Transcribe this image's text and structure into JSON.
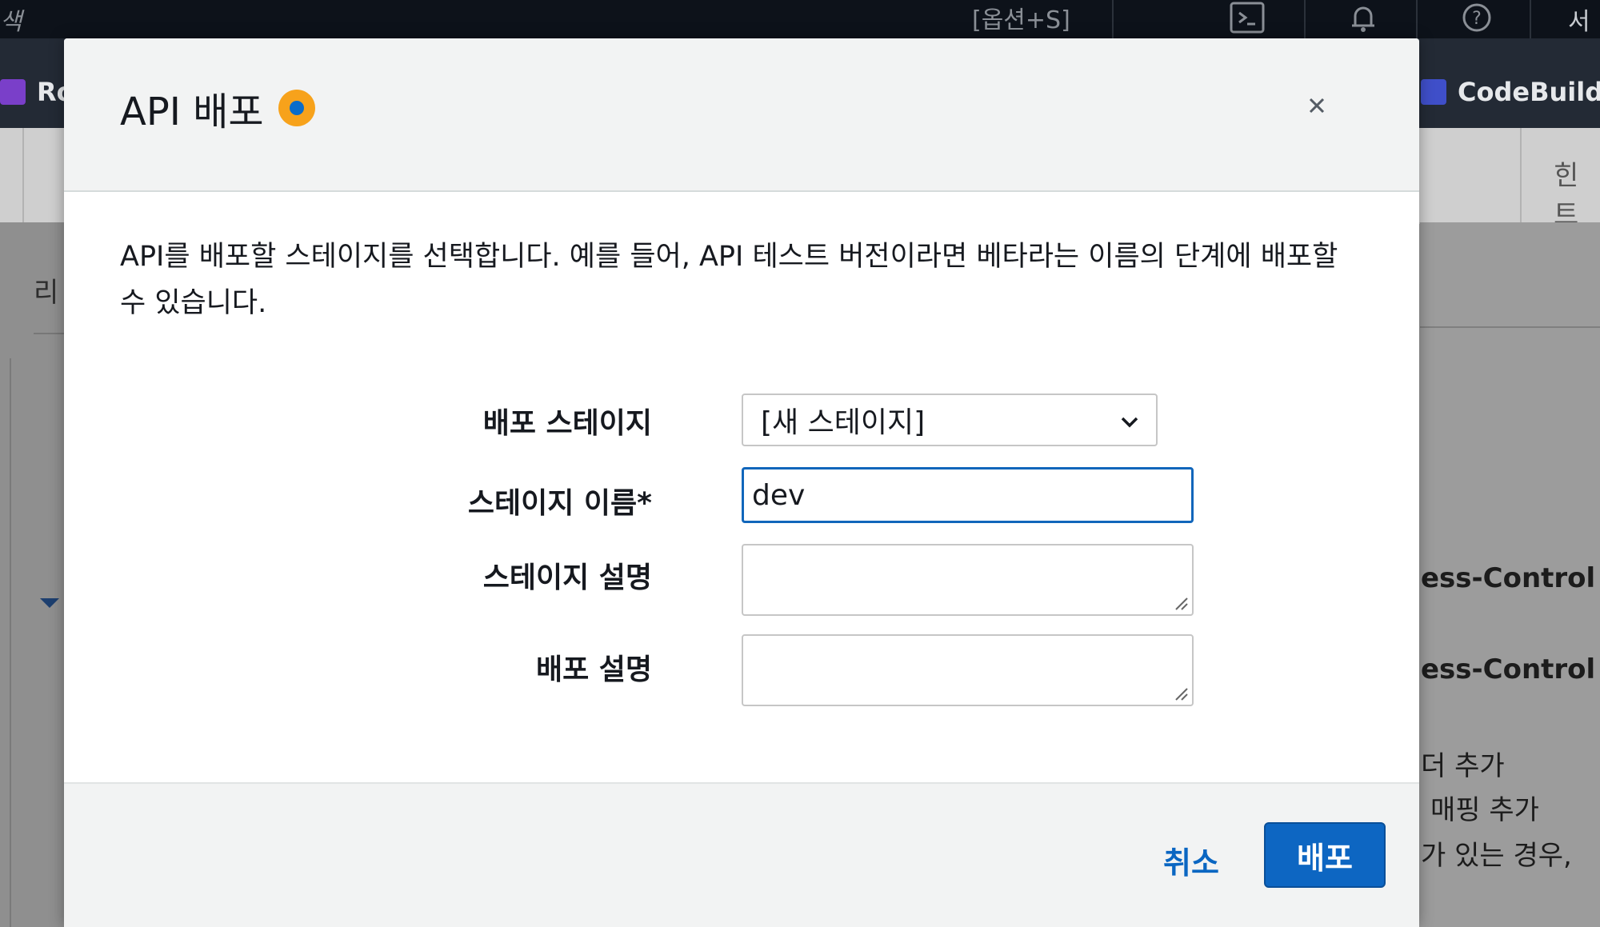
{
  "background": {
    "topbar": {
      "search_fragment": "색",
      "shortcut_hint": "[옵션+S]",
      "user_fragment": "서"
    },
    "favorites": [
      {
        "label": "Ro",
        "icon": "resource-icon"
      },
      {
        "label": "CodeBuild",
        "icon": "codebuild-icon"
      }
    ],
    "subbar": {
      "hint_fragment": "힌트"
    },
    "left_panel": {
      "fragment": "리"
    },
    "right_panel": {
      "lines": [
        "ess-Control",
        "ess-Control",
        "더 추가",
        "매핑 추가",
        "가 있는 경우,"
      ]
    }
  },
  "modal": {
    "title": "API 배포",
    "description": "API를 배포할 스테이지를 선택합니다. 예를 들어, API 테스트 버전이라면 베타라는 이름의 단계에 배포할 수 있습니다.",
    "form": {
      "stage_label": "배포 스테이지",
      "stage_selected": "[새 스테이지]",
      "stage_name_label": "스테이지 이름*",
      "stage_name_value": "dev",
      "stage_desc_label": "스테이지 설명",
      "stage_desc_value": "",
      "deploy_desc_label": "배포 설명",
      "deploy_desc_value": ""
    },
    "footer": {
      "cancel_label": "취소",
      "deploy_label": "배포"
    },
    "colors": {
      "accent": "#0d66c2",
      "beta_badge": "#f7a21b"
    }
  }
}
